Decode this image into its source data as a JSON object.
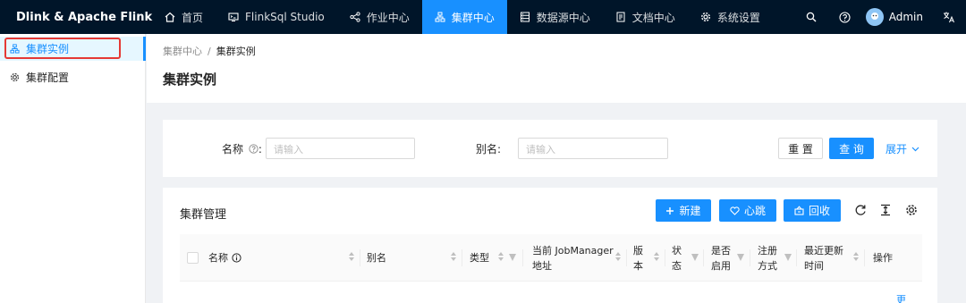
{
  "app": {
    "name": "Dlink & Apache Flink"
  },
  "nav": [
    {
      "label": "首页",
      "icon": "home-icon",
      "active": false
    },
    {
      "label": "FlinkSql Studio",
      "icon": "console-icon",
      "active": false
    },
    {
      "label": "作业中心",
      "icon": "share-nodes-icon",
      "active": false
    },
    {
      "label": "集群中心",
      "icon": "cluster-icon",
      "active": true
    },
    {
      "label": "数据源中心",
      "icon": "database-icon",
      "active": false
    },
    {
      "label": "文档中心",
      "icon": "document-icon",
      "active": false
    },
    {
      "label": "系统设置",
      "icon": "gear-icon",
      "active": false
    }
  ],
  "header_right": {
    "user": "Admin"
  },
  "sidebar": {
    "items": [
      {
        "label": "集群实例",
        "icon": "cluster-icon",
        "active": true
      },
      {
        "label": "集群配置",
        "icon": "gear-icon",
        "active": false
      }
    ]
  },
  "breadcrumb": {
    "parent": "集群中心",
    "separator": "/",
    "current": "集群实例"
  },
  "page": {
    "title": "集群实例"
  },
  "search": {
    "name_label": "名称",
    "name_colon": ":",
    "name_placeholder": "请输入",
    "alias_label": "别名:",
    "alias_placeholder": "请输入",
    "reset_label": "重 置",
    "query_label": "查 询",
    "expand_label": "展开"
  },
  "table": {
    "title": "集群管理",
    "new_label": "新建",
    "heartbeat_label": "心跳",
    "recycle_label": "回收",
    "columns": [
      {
        "label": "名称"
      },
      {
        "label": "别名"
      },
      {
        "label": "类型"
      },
      {
        "label": "当前 JobManager\n地址"
      },
      {
        "label": "版\n本"
      },
      {
        "label": "状\n态"
      },
      {
        "label": "是否\n启用"
      },
      {
        "label": "注册\n方式"
      },
      {
        "label": "最近更新\n时间"
      },
      {
        "label": "操作"
      }
    ],
    "more_label": "更"
  },
  "colors": {
    "accent": "#1890ff",
    "header_bg": "#001529",
    "highlight": "#e53935"
  }
}
